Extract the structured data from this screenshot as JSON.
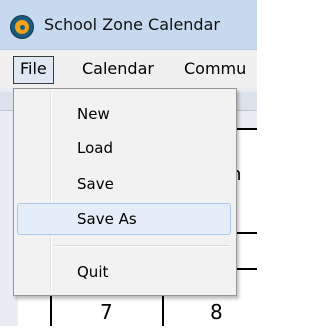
{
  "window": {
    "title": "School Zone Calendar"
  },
  "menubar": {
    "items": [
      {
        "label": "File"
      },
      {
        "label": "Calendar"
      },
      {
        "label": "Commu"
      }
    ]
  },
  "file_menu": {
    "items": [
      {
        "label": "New"
      },
      {
        "label": "Load"
      },
      {
        "label": "Save"
      },
      {
        "label": "Save As",
        "highlighted": true
      },
      {
        "label": "Quit"
      }
    ]
  },
  "background": {
    "visible_letter": "n",
    "day_numbers": [
      "7",
      "8"
    ]
  },
  "colors": {
    "titlebar": "#c7d9ee",
    "menubar": "#f0f0f0",
    "menu_highlight": "#e5eef8",
    "app_icon": "#f0a31a"
  }
}
